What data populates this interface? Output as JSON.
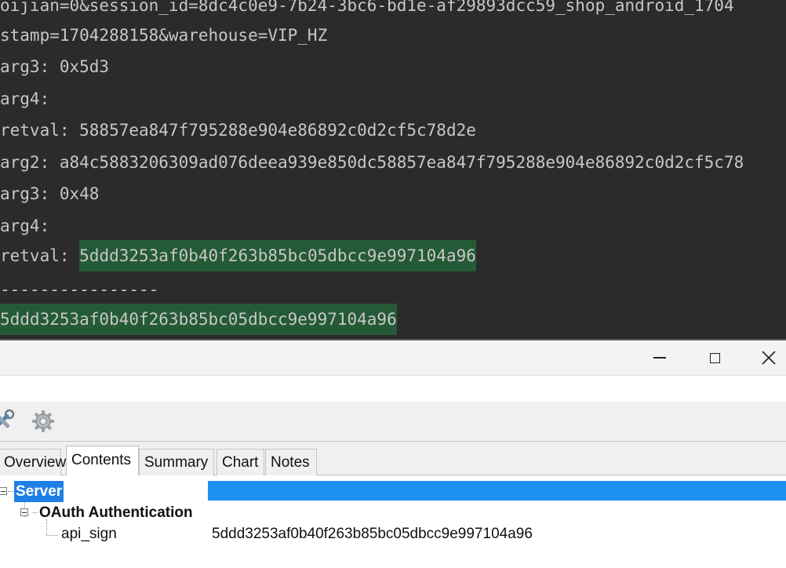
{
  "console": {
    "lines": [
      "oijian=0&session_id=8dc4c0e9-7b24-3bc6-bd1e-af29893dcc59_shop_android_1704",
      "stamp=1704288158&warehouse=VIP_HZ",
      "arg3: 0x5d3",
      "arg4:",
      "retval: 58857ea847f795288e904e86892c0d2cf5c78d2e",
      "arg2: a84c5883206309ad076deea939e850dc58857ea847f795288e904e86892c0d2cf5c78",
      "arg3: 0x48",
      "arg4:",
      "retval: ",
      "----------------",
      ""
    ],
    "highlighted_retval": "5ddd3253af0b40f263b85bc05dbcc9e997104a96",
    "highlighted_result": "5ddd3253af0b40f263b85bc05dbcc9e997104a96",
    "highlight_color": "#255a36",
    "background_color": "#2b2b2b"
  },
  "window": {
    "minimize_icon": "minimize-icon",
    "maximize_icon": "maximize-icon",
    "close_icon": "close-icon"
  },
  "toolbar": {
    "icons": [
      "tools-icon",
      "gear-icon"
    ]
  },
  "tabs": [
    {
      "label": "Overview",
      "active": false
    },
    {
      "label": "Contents",
      "active": true
    },
    {
      "label": "Summary",
      "active": false
    },
    {
      "label": "Chart",
      "active": false
    },
    {
      "label": "Notes",
      "active": false
    }
  ],
  "tree": {
    "root": {
      "label": "Server",
      "selected": true
    },
    "child": {
      "label": "OAuth Authentication"
    },
    "leaf": {
      "label": "api_sign",
      "value": "5ddd3253af0b40f263b85bc05dbcc9e997104a96"
    },
    "selection_color": "#1e7fe6"
  }
}
